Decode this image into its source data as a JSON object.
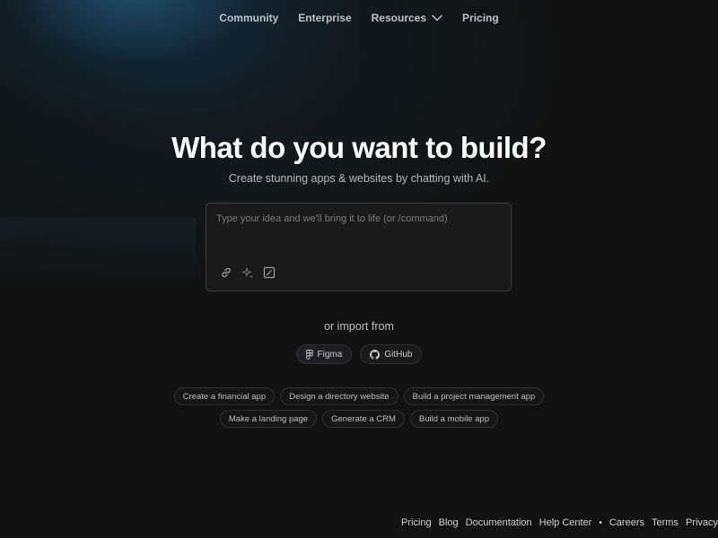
{
  "nav": {
    "items": [
      {
        "label": "Community"
      },
      {
        "label": "Enterprise"
      },
      {
        "label": "Resources",
        "has_dropdown": true,
        "icon": "chevron-down-icon"
      },
      {
        "label": "Pricing"
      }
    ]
  },
  "hero": {
    "title": "What do you want to build?",
    "subtitle": "Create stunning apps & websites by chatting with AI."
  },
  "prompt": {
    "value": "",
    "placeholder": "Type your idea and we'll bring it to life (or /command)",
    "tools": [
      {
        "icon": "link-icon"
      },
      {
        "icon": "sparkle-icon"
      },
      {
        "icon": "expand-icon"
      }
    ]
  },
  "import": {
    "label": "or import from",
    "sources": [
      {
        "label": "Figma",
        "icon": "figma-icon"
      },
      {
        "label": "GitHub",
        "icon": "github-icon"
      }
    ]
  },
  "suggestions": {
    "row1": [
      "Create a financial app",
      "Design a directory website",
      "Build a project management app"
    ],
    "row2": [
      "Make a landing page",
      "Generate a CRM",
      "Build a mobile app"
    ]
  },
  "footer": {
    "links_left": [
      "Pricing",
      "Blog",
      "Documentation",
      "Help Center"
    ],
    "separator": "•",
    "links_right": [
      "Careers",
      "Terms",
      "Privacy"
    ]
  },
  "colors": {
    "background": "#121212",
    "glow": "#2678aa",
    "text_primary": "#ffffff",
    "text_muted": "#b8b8b8",
    "border": "#3a3a3a"
  }
}
